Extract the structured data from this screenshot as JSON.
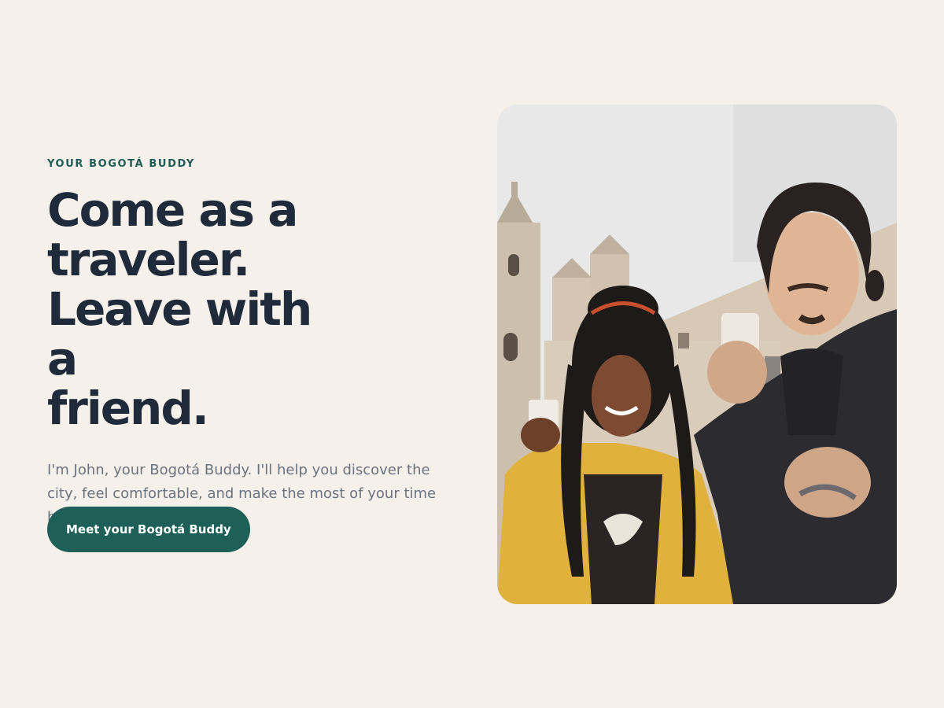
{
  "hero": {
    "eyebrow": "YOUR BOGOTÁ BUDDY",
    "headline_lines": [
      "Come as a",
      "traveler.",
      "Leave with a",
      "friend."
    ],
    "lead": "I'm John, your Bogotá Buddy. I'll help you discover the city, feel comfortable, and make the most of your time here.",
    "cta_label": "Meet your Bogotá Buddy"
  },
  "photo": {
    "description_icon": "travelers-photo"
  },
  "colors": {
    "background": "#f5f0e9",
    "accent": "#1e5f58",
    "heading": "#1f2a3a",
    "body_text": "#6b7280",
    "eyebrow": "#1f5c57"
  }
}
